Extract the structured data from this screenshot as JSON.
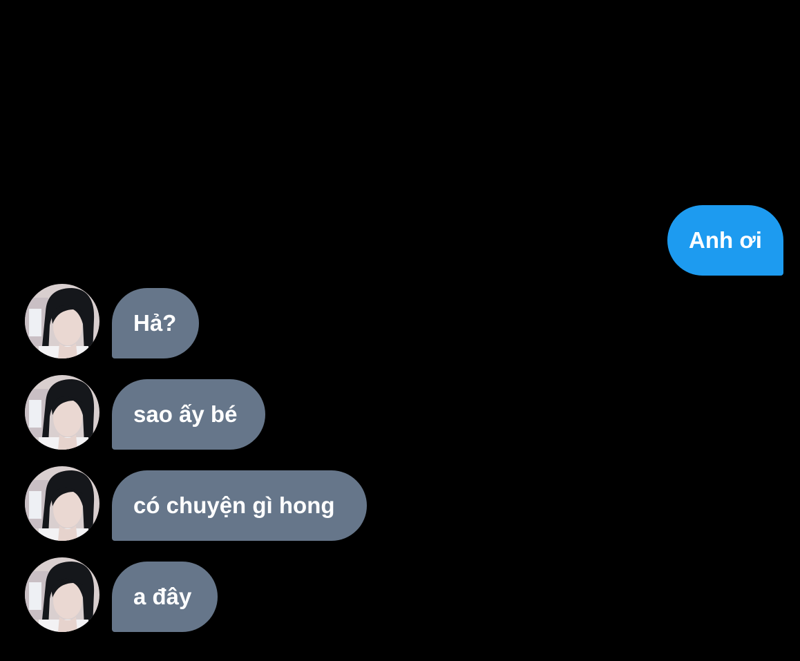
{
  "conversation": {
    "sent": [
      {
        "text": "Anh ơi"
      }
    ],
    "received": [
      {
        "text": "Hả?"
      },
      {
        "text": "sao ấy bé"
      },
      {
        "text": "có chuyện gì hong"
      },
      {
        "text": "a đây"
      }
    ]
  },
  "colors": {
    "background": "#000000",
    "sent_bubble": "#1d9bf0",
    "received_bubble": "#66768a",
    "text": "#ffffff"
  },
  "icons": {
    "avatar": "contact-avatar-photo"
  }
}
